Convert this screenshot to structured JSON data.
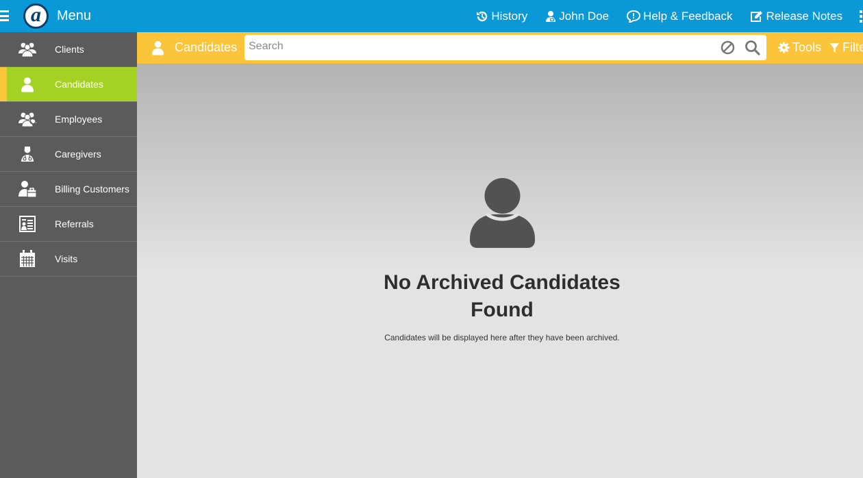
{
  "topbar": {
    "menu_label": "Menu",
    "logo_letter": "a",
    "nav": [
      {
        "label": "History",
        "icon": "history-icon"
      },
      {
        "label": "John Doe",
        "icon": "user-icon"
      },
      {
        "label": "Help & Feedback",
        "icon": "help-icon"
      },
      {
        "label": "Release Notes",
        "icon": "edit-icon"
      }
    ]
  },
  "sidebar": {
    "items": [
      {
        "label": "Clients",
        "icon": "clients-icon"
      },
      {
        "label": "Candidates",
        "icon": "candidate-icon",
        "active": true
      },
      {
        "label": "Employees",
        "icon": "employees-icon"
      },
      {
        "label": "Caregivers",
        "icon": "caregiver-icon"
      },
      {
        "label": "Billing Customers",
        "icon": "billing-icon"
      },
      {
        "label": "Referrals",
        "icon": "referrals-icon"
      },
      {
        "label": "Visits",
        "icon": "calendar-icon"
      }
    ]
  },
  "subheader": {
    "title": "Candidates",
    "search_placeholder": "Search",
    "search_value": "",
    "tools_label": "Tools",
    "filter_label": "Filte"
  },
  "empty_state": {
    "title": "No Archived Candidates Found",
    "subtitle": "Candidates will be displayed here after they have been archived."
  },
  "colors": {
    "topbar": "#0a98d6",
    "sidebar": "#5b5b5b",
    "active_item": "#a5d125",
    "subheader": "#fbc43b"
  }
}
